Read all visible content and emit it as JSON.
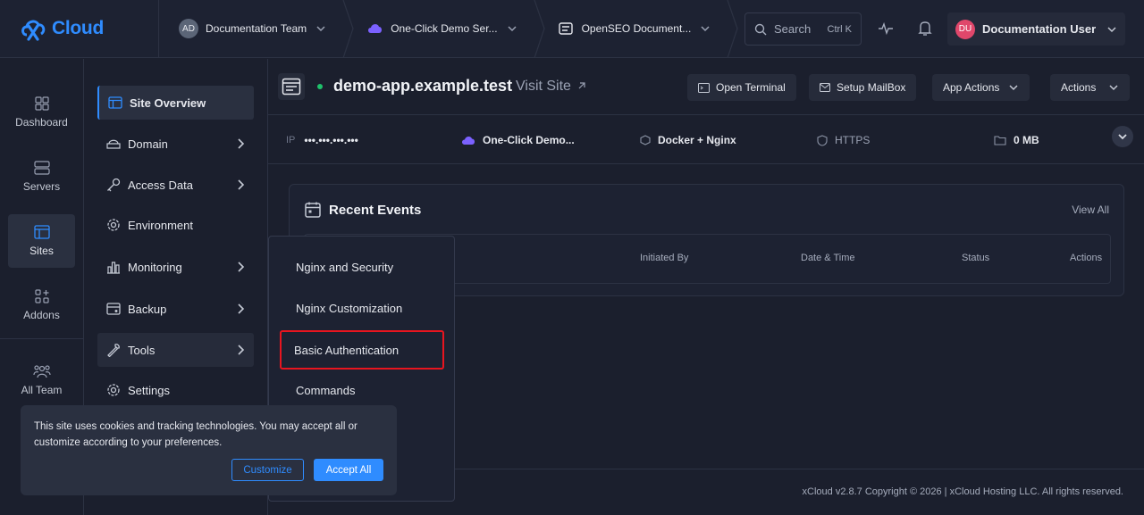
{
  "brand": {
    "name": "Cloud",
    "color": "#2f8cff"
  },
  "topbar": {
    "breadcrumbs": [
      {
        "avatar": "AD",
        "label": "Documentation Team"
      },
      {
        "icon": "cloud-icon",
        "label": "One-Click Demo Ser..."
      },
      {
        "icon": "server-list-icon",
        "label": "OpenSEO Document..."
      }
    ],
    "search": {
      "label": "Search",
      "shortcut": "Ctrl K"
    },
    "user": {
      "initials": "DU",
      "name": "Documentation User"
    }
  },
  "rail": {
    "items": [
      {
        "label": "Dashboard",
        "icon": "dashboard-icon"
      },
      {
        "label": "Servers",
        "icon": "servers-icon"
      },
      {
        "label": "Sites",
        "icon": "sites-icon",
        "active": true
      },
      {
        "label": "Addons",
        "icon": "addons-icon"
      },
      {
        "label": "All Team",
        "icon": "team-icon"
      }
    ]
  },
  "sidebar": {
    "items": [
      {
        "label": "Site Overview",
        "icon": "site-overview-icon",
        "active": true
      },
      {
        "label": "Domain",
        "icon": "domain-icon",
        "has_submenu": true
      },
      {
        "label": "Access Data",
        "icon": "key-icon",
        "has_submenu": true
      },
      {
        "label": "Environment",
        "icon": "gear-icon"
      },
      {
        "label": "Monitoring",
        "icon": "chart-icon",
        "has_submenu": true
      },
      {
        "label": "Backup",
        "icon": "backup-icon",
        "has_submenu": true
      },
      {
        "label": "Tools",
        "icon": "wrench-icon",
        "has_submenu": true,
        "hover": true
      },
      {
        "label": "Settings",
        "icon": "settings-icon"
      }
    ]
  },
  "site": {
    "title": "demo-app.example.test",
    "visit_site": "Visit Site",
    "status_color": "#1fc16b",
    "buttons": {
      "open_terminal": "Open Terminal",
      "setup_mailbox": "Setup MailBox",
      "app_actions": "App Actions",
      "actions": "Actions"
    },
    "info": {
      "ip_label": "IP",
      "ip_value": "•••.•••.•••.•••",
      "provider": "One-Click Demo...",
      "stack": "Docker + Nginx",
      "https": "HTTPS",
      "storage": "0 MB"
    }
  },
  "recent_events": {
    "title": "Recent Events",
    "view_all": "View All",
    "columns": [
      "Initiated By",
      "Date & Time",
      "Status",
      "Actions"
    ]
  },
  "tools_submenu": {
    "items": [
      "Nginx and Security",
      "Nginx Customization",
      "Basic Authentication",
      "Commands"
    ],
    "highlighted": "Basic Authentication",
    "highlight_color": "#e8151f"
  },
  "footer": {
    "text": "xCloud v2.8.7 Copyright © 2026 | xCloud Hosting LLC. All rights reserved."
  },
  "cookie": {
    "text": "This site uses cookies and tracking technologies. You may accept all or customize according to your preferences.",
    "customize": "Customize",
    "accept_all": "Accept All"
  }
}
